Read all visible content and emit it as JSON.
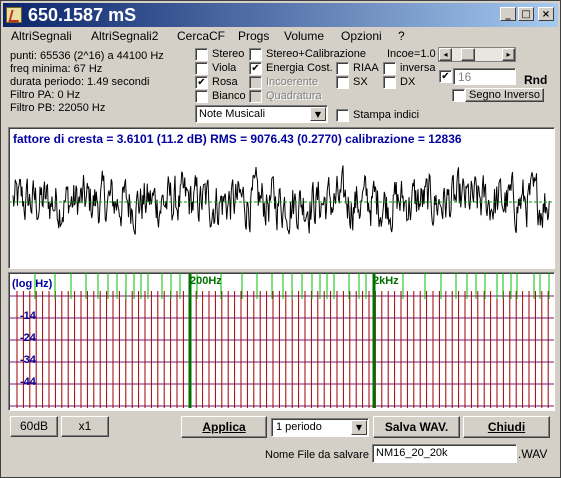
{
  "window": {
    "title": "650.1587 mS"
  },
  "menu": [
    "AltriSegnali",
    "AltriSegnali2",
    "CercaCF",
    "Progs",
    "Volume",
    "Opzioni",
    "?"
  ],
  "info": {
    "punti": "punti: 65536 (2^16) a 44100 Hz",
    "freq_min": "freq minima:  67 Hz",
    "durata": "durata periodo: 1.49 secondi",
    "filtro_pa": "Filtro PA: 0 Hz",
    "filtro_pb": "Filtro PB: 22050 Hz"
  },
  "checkboxes": {
    "stereo": {
      "label": "Stereo",
      "checked": false
    },
    "viola": {
      "label": "Viola",
      "checked": false
    },
    "rosa": {
      "label": "Rosa",
      "checked": true
    },
    "bianco": {
      "label": "Bianco",
      "checked": false
    },
    "stereo_calib": {
      "label": "Stereo+Calibrazione",
      "checked": false
    },
    "energia": {
      "label": "Energia Cost.",
      "checked": true
    },
    "incoerente": {
      "label": "Incoerente",
      "checked": false
    },
    "quadratura": {
      "label": "Quadratura",
      "checked": false
    },
    "riaa": {
      "label": "RIAA",
      "checked": false
    },
    "inversa": {
      "label": "inversa",
      "checked": false
    },
    "sx": {
      "label": "SX",
      "checked": false
    },
    "dx": {
      "label": "DX",
      "checked": false
    },
    "numeric_check": {
      "checked": true
    },
    "segno_inverso": {
      "label": "Segno Inverso",
      "checked": false
    },
    "stampa_indici": {
      "label": "Stampa indici",
      "checked": false
    }
  },
  "incoe": {
    "label": "Incoe=1.0"
  },
  "numeric_field": "16",
  "rnd_label": "Rnd",
  "note_combo": "Note Musicali",
  "waveform": {
    "header": "fattore di cresta = 3.6101 (11.2 dB) RMS = 9076.43 (0.2770)  calibrazione = 12836"
  },
  "spectrum": {
    "log_label": "(log Hz)",
    "label_200": "200Hz",
    "label_2k": "2kHz",
    "db_labels": [
      "-14",
      "-24",
      "-34",
      "-44"
    ]
  },
  "colors": {
    "title_start": "#0a246a",
    "title_end": "#a6caf0",
    "wave": "#000000",
    "zero_line": "#00a000",
    "h_grid": "#7a1a7a",
    "v_red": "#a00000",
    "v_green": "#00c000",
    "text_blue": "#0000a0"
  },
  "buttons": {
    "b60db": "60dB",
    "x1": "x1",
    "applica": "Applica",
    "salva": "Salva WAV.",
    "chiudi": "Chiudi"
  },
  "periodo_combo": "1 periodo",
  "filename": {
    "label": "Nome File da salvare",
    "value": "NM16_20_20k",
    "ext": ".WAV"
  }
}
